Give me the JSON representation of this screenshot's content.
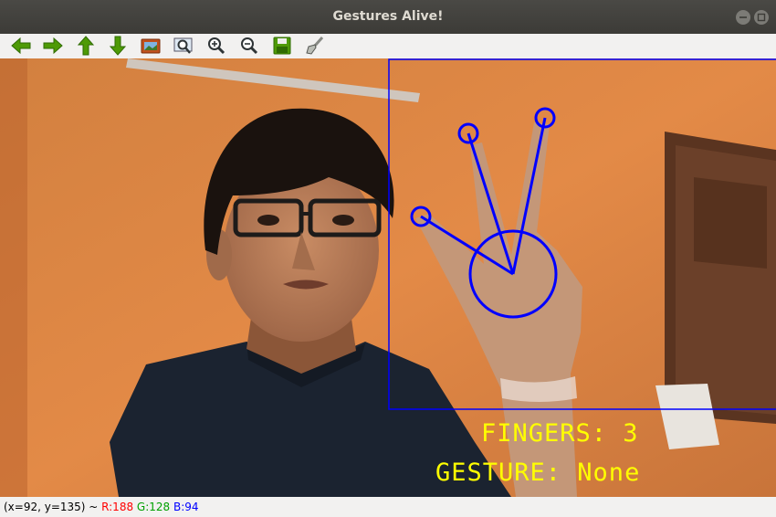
{
  "window": {
    "title": "Gestures Alive!",
    "minimize_icon": "minimize-icon",
    "maximize_icon": "maximize-icon"
  },
  "toolbar": {
    "buttons": [
      {
        "name": "pan-left-button",
        "icon": "arrow-left-icon"
      },
      {
        "name": "pan-right-button",
        "icon": "arrow-right-icon"
      },
      {
        "name": "pan-up-button",
        "icon": "arrow-up-icon"
      },
      {
        "name": "pan-down-button",
        "icon": "arrow-down-icon"
      },
      {
        "name": "zoom-image-button",
        "icon": "image-icon"
      },
      {
        "name": "zoom-fit-button",
        "icon": "zoom-region-icon"
      },
      {
        "name": "zoom-in-button",
        "icon": "zoom-in-icon"
      },
      {
        "name": "zoom-out-button",
        "icon": "zoom-out-icon"
      },
      {
        "name": "save-button",
        "icon": "save-icon"
      },
      {
        "name": "properties-button",
        "icon": "brush-icon"
      }
    ]
  },
  "overlay": {
    "fingers_label": "FINGERS: 3",
    "gesture_label": "GESTURE: None"
  },
  "status": {
    "coords": "(x=92, y=135) ~ ",
    "r": "R:188",
    "g": "G:128",
    "b": "B:94",
    "colors": {
      "r": "#ff0000",
      "g": "#00a000",
      "b": "#0000ff"
    }
  }
}
